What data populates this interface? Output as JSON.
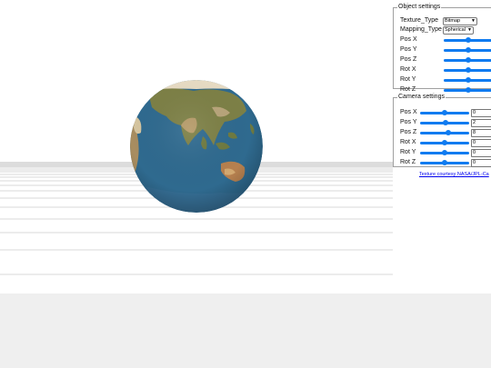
{
  "object_settings": {
    "legend": "Object settings",
    "texture_type": {
      "label": "Texture_Type",
      "value": "Bitmap"
    },
    "mapping_type": {
      "label": "Mapping_Type",
      "value": "Spherical"
    },
    "sliders": [
      {
        "label": "Pos X",
        "fraction": 0.5
      },
      {
        "label": "Pos Y",
        "fraction": 0.5
      },
      {
        "label": "Pos Z",
        "fraction": 0.5
      },
      {
        "label": "Rot X",
        "fraction": 0.5
      },
      {
        "label": "Rot Y",
        "fraction": 0.5
      },
      {
        "label": "Rot Z",
        "fraction": 0.5
      }
    ]
  },
  "camera_settings": {
    "legend": "Camera settings",
    "rows": [
      {
        "label": "Pos X",
        "value": "0",
        "fraction": 0.5
      },
      {
        "label": "Pos Y",
        "value": "2",
        "fraction": 0.52
      },
      {
        "label": "Pos Z",
        "value": "8",
        "fraction": 0.58
      },
      {
        "label": "Rot X",
        "value": "0",
        "fraction": 0.5
      },
      {
        "label": "Rot Y",
        "value": "0",
        "fraction": 0.5
      },
      {
        "label": "Rot Z",
        "value": "0",
        "fraction": 0.5
      }
    ]
  },
  "credit": {
    "text": "Texture courtesy NASA/JPL-Ca"
  },
  "colors": {
    "slider": "#0f7bf0",
    "ocean": "#2f6a8f",
    "land": "#8a8a55",
    "ice": "#e8dcc4"
  }
}
